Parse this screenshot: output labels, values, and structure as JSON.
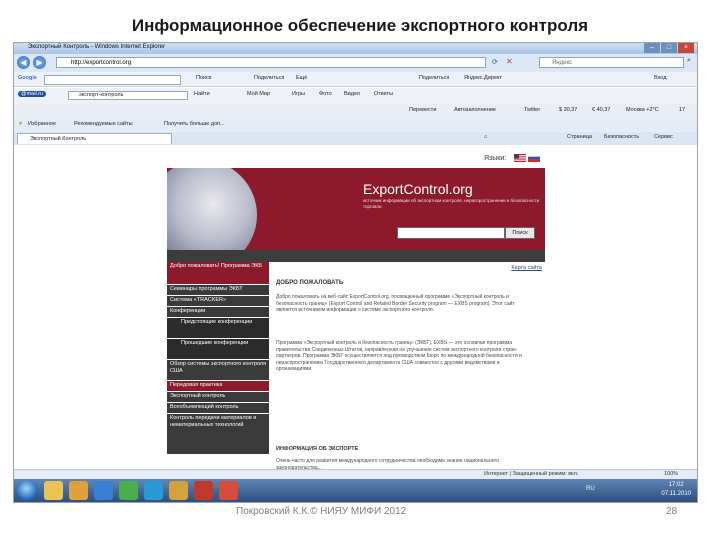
{
  "slide": {
    "title": "Информационное обеспечение экспортного контроля",
    "footer_left": "Покровский К.К.© НИЯУ МИФИ 2012",
    "page_number": "28"
  },
  "browser": {
    "window_title": "Экспортный Контроль - Windows Internet Explorer",
    "url": "http://exportcontrol.org",
    "search_placeholder": "Яндекс",
    "google_toolbar": [
      "Google",
      "Поиск",
      "Поделиться",
      "Ещё",
      "Вход"
    ],
    "google_extra": [
      "Поделиться",
      "Яндекс.Директ",
      "Вход"
    ],
    "mail_toolbar": [
      "@mail.ru",
      "экспорт-контроль",
      "Найти",
      "Мой Мир",
      "Игры",
      "Фото",
      "Видео",
      "Ответы"
    ],
    "ru_toolbar": [
      "Перевести",
      "Автозаполнение",
      "Twitter",
      "$ 30,37",
      "€ 40,37",
      "Москва +2°C",
      "17"
    ],
    "favorites_label": "Избранное",
    "favorites_items": [
      "Рекомендуемые сайты",
      "Получить больше доп..."
    ],
    "tab_label": "Экспортный Контроль",
    "command_items": [
      "Страница",
      "Безопасность",
      "Сервис"
    ],
    "status_text": "Интернет | Защищенный режим: вкл.",
    "zoom": "100%"
  },
  "site": {
    "languages_label": "Языки:",
    "title": "ExportControl.org",
    "subtitle": "источник информации об экспортном контроле, нераспространении и безопасности торговли",
    "search_button": "Поиск",
    "sitemap_link": "Карта сайта",
    "sidebar": [
      {
        "label": "Добро пожаловать! Программа ЭКБ",
        "style": "head"
      },
      {
        "label": "Семинары программы ЭКБТ",
        "style": "normal"
      },
      {
        "label": "Система «TRACKER»",
        "style": "normal"
      },
      {
        "label": "Конференции",
        "style": "normal"
      },
      {
        "label": "Предстоящие конференции",
        "style": "sub"
      },
      {
        "label": "Прошедшие конференции",
        "style": "sub"
      },
      {
        "label": "Обзор системы экспортного контроля США",
        "style": "normal"
      },
      {
        "label": "Передовая практика",
        "style": "head"
      },
      {
        "label": "Экспортный контроль",
        "style": "normal"
      },
      {
        "label": "Всеобъемлющий контроль",
        "style": "normal"
      },
      {
        "label": "Контроль передачи материалов и нематериальных технологий",
        "style": "normal"
      }
    ],
    "welcome_heading": "ДОБРО ПОЖАЛОВАТЬ",
    "welcome_text": "Добро пожаловать на веб-сайт ExportControl.org, посвященный программе «Экспортный контроль и безопасность границ» (Export Control and Related Border Security program — EXBS program). Этот сайт является источником информации о системе экспортного контроля.",
    "program_text": "Программа «Экспортный контроль и безопасность границ» (ЭКБГ), EXBS — это основная программа правительства Соединенных Штатов, направленная на улучшение систем экспортного контроля стран-партнеров. Программа ЭКБГ осуществляется под руководством Бюро по международной безопасности и нераспространению Государственного департамента США совместно с другими ведомствами и организациями.",
    "info_heading": "ИНФОРМАЦИЯ ОБ ЭКСПОРТЕ",
    "info_text": "Очень часто для развития международного сотрудничества необходимо знание национального законодательства..."
  },
  "taskbar": {
    "language": "RU",
    "time": "17:02",
    "date": "07.11.2010"
  },
  "colors": {
    "site_header": "#8c1a2b",
    "sidebar_dark": "#3a3a3a",
    "sidebar_head": "#8c1a2b",
    "taskbar": "#2c4f7e"
  }
}
